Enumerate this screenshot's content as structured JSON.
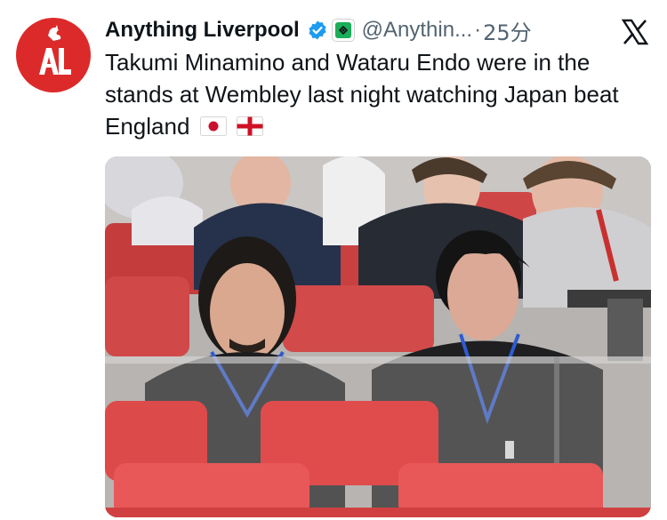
{
  "tweet": {
    "author_name": "Anything Liverpool",
    "handle": "@Anythin...",
    "separator": "·",
    "timestamp": "25分",
    "text": "Takumi Minamino and Wataru Endo were in the stands at Wembley last night watching Japan beat England",
    "emoji": [
      "japan-flag",
      "england-flag"
    ],
    "avatar_monogram": "AL"
  },
  "colors": {
    "avatar_bg": "#dc2a2a",
    "verified": "#1d9bf0",
    "affiliate_green": "#1bae5a",
    "text": "#0f1419",
    "muted": "#536471"
  }
}
